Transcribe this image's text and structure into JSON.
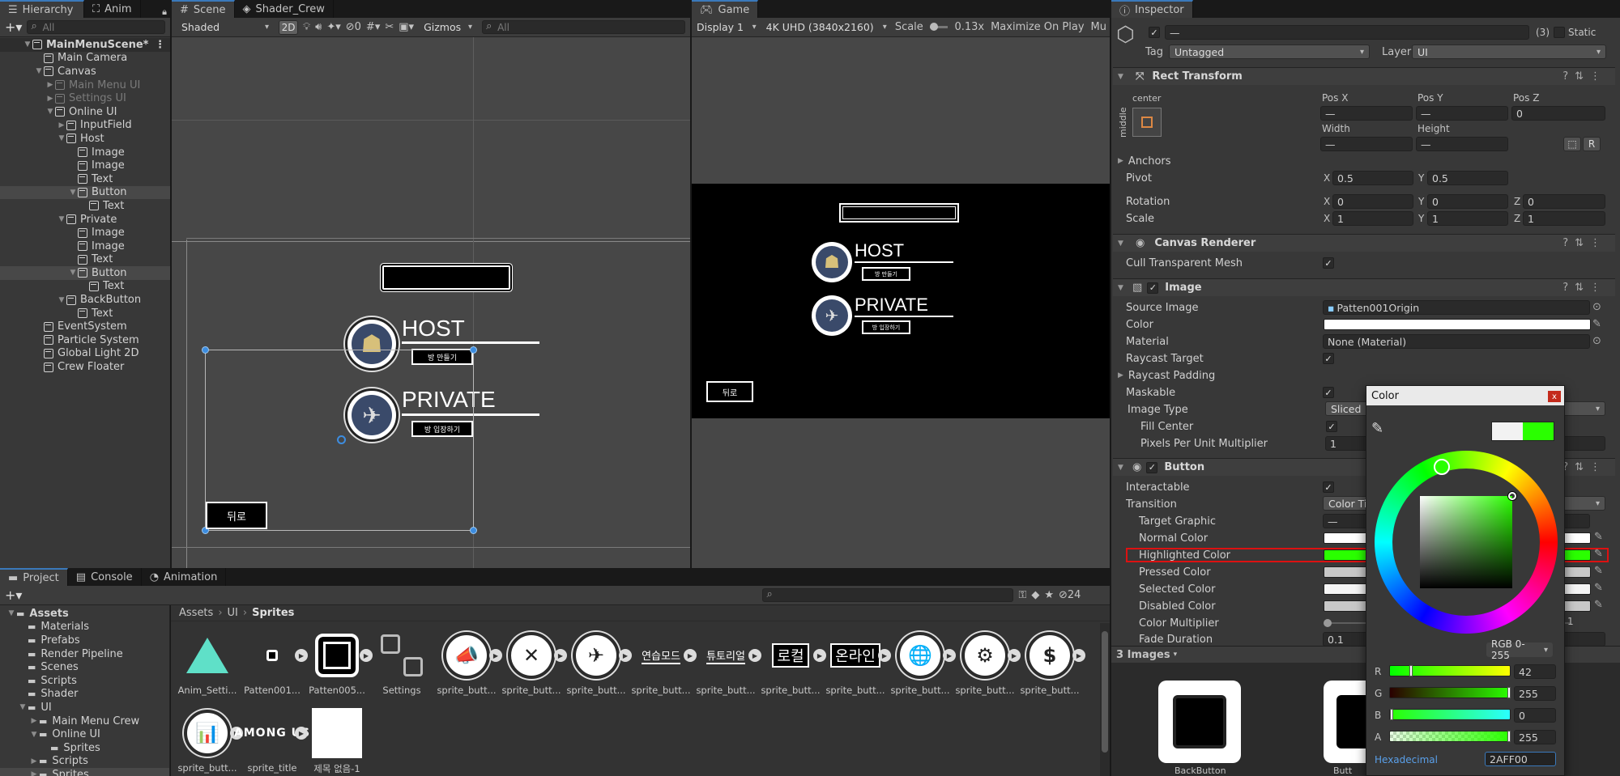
{
  "hierarchy": {
    "tabs": [
      "Hierarchy",
      "Anim"
    ],
    "search_placeholder": "All",
    "items": [
      {
        "label": "MainMenuScene*",
        "depth": 0,
        "kind": "scene",
        "expanded": true
      },
      {
        "label": "Main Camera",
        "depth": 1
      },
      {
        "label": "Canvas",
        "depth": 1,
        "expanded": true
      },
      {
        "label": "Main Menu UI",
        "depth": 2,
        "collapsed": true,
        "dim": true
      },
      {
        "label": "Settings UI",
        "depth": 2,
        "collapsed": true,
        "dim": true
      },
      {
        "label": "Online UI",
        "depth": 2,
        "expanded": true
      },
      {
        "label": "InputField",
        "depth": 3,
        "collapsed": true
      },
      {
        "label": "Host",
        "depth": 3,
        "expanded": true
      },
      {
        "label": "Image",
        "depth": 4
      },
      {
        "label": "Image",
        "depth": 4
      },
      {
        "label": "Text",
        "depth": 4
      },
      {
        "label": "Button",
        "depth": 4,
        "expanded": true,
        "selected": true
      },
      {
        "label": "Text",
        "depth": 5
      },
      {
        "label": "Private",
        "depth": 3,
        "expanded": true
      },
      {
        "label": "Image",
        "depth": 4
      },
      {
        "label": "Image",
        "depth": 4
      },
      {
        "label": "Text",
        "depth": 4
      },
      {
        "label": "Button",
        "depth": 4,
        "expanded": true,
        "selected": true
      },
      {
        "label": "Text",
        "depth": 5
      },
      {
        "label": "BackButton",
        "depth": 3,
        "expanded": true
      },
      {
        "label": "Text",
        "depth": 4
      },
      {
        "label": "EventSystem",
        "depth": 1
      },
      {
        "label": "Particle System",
        "depth": 1
      },
      {
        "label": "Global Light 2D",
        "depth": 1
      },
      {
        "label": "Crew Floater",
        "depth": 1
      }
    ]
  },
  "scene": {
    "tabs": [
      "Scene",
      "Shader_Crew"
    ],
    "shading": "Shaded",
    "mode2d": "2D",
    "gizmos": "Gizmos",
    "search_placeholder": "All",
    "hidden_count": "0",
    "host_label": "HOST",
    "host_button": "방 만들기",
    "private_label": "PRIVATE",
    "private_button": "방 입장하기",
    "back_button": "뒤로"
  },
  "game": {
    "tab": "Game",
    "display": "Display 1",
    "resolution": "4K UHD (3840x2160)",
    "scale_label": "Scale",
    "scale_value": "0.13x",
    "maximize": "Maximize On Play",
    "mute": "Mu",
    "host_label": "HOST",
    "host_button": "방 만들기",
    "private_label": "PRIVATE",
    "private_button": "방 입장하기",
    "back_button": "뒤로"
  },
  "project": {
    "tabs": [
      "Project",
      "Console",
      "Animation"
    ],
    "hidden_count": "24",
    "tree": [
      {
        "label": "Assets",
        "depth": 0,
        "bold": true
      },
      {
        "label": "Materials",
        "depth": 1
      },
      {
        "label": "Prefabs",
        "depth": 1
      },
      {
        "label": "Render Pipeline",
        "depth": 1
      },
      {
        "label": "Scenes",
        "depth": 1
      },
      {
        "label": "Scripts",
        "depth": 1
      },
      {
        "label": "Shader",
        "depth": 1
      },
      {
        "label": "UI",
        "depth": 1,
        "open": true
      },
      {
        "label": "Main Menu Crew",
        "depth": 2
      },
      {
        "label": "Online UI",
        "depth": 2,
        "open": true
      },
      {
        "label": "Sprites",
        "depth": 3
      },
      {
        "label": "Scripts",
        "depth": 2
      },
      {
        "label": "Sprites",
        "depth": 2,
        "selected": true
      }
    ],
    "breadcrumb": [
      "Assets",
      "UI",
      "Sprites"
    ],
    "assets": [
      {
        "label": "Anim_Setti...",
        "kind": "anim"
      },
      {
        "label": "Patten001...",
        "kind": "smallsq"
      },
      {
        "label": "Patten005...",
        "kind": "bigsq"
      },
      {
        "label": "Settings",
        "kind": "settings"
      },
      {
        "label": "sprite_butt...",
        "kind": "circle",
        "glyph": "📣"
      },
      {
        "label": "sprite_butt...",
        "kind": "circle",
        "glyph": "✕"
      },
      {
        "label": "sprite_butt...",
        "kind": "circle",
        "glyph": "✈"
      },
      {
        "label": "sprite_butt...",
        "kind": "text",
        "glyph": "연습모드"
      },
      {
        "label": "sprite_butt...",
        "kind": "text",
        "glyph": "튜토리얼"
      },
      {
        "label": "sprite_butt...",
        "kind": "boxtext",
        "glyph": "로컬"
      },
      {
        "label": "sprite_butt...",
        "kind": "boxtext",
        "glyph": "온라인"
      },
      {
        "label": "sprite_butt...",
        "kind": "circle",
        "glyph": "🌐"
      },
      {
        "label": "sprite_butt...",
        "kind": "circle",
        "glyph": "⚙"
      },
      {
        "label": "sprite_butt...",
        "kind": "circle",
        "glyph": "$"
      },
      {
        "label": "sprite_butt...",
        "kind": "circle",
        "glyph": "📊"
      },
      {
        "label": "sprite_title",
        "kind": "title",
        "glyph": "AMONG US"
      },
      {
        "label": "제목 없음-1",
        "kind": "white"
      }
    ]
  },
  "inspector": {
    "tab": "Inspector",
    "name": "—",
    "count": "(3)",
    "static": "Static",
    "tag_label": "Tag",
    "tag": "Untagged",
    "layer_label": "Layer",
    "layer": "UI",
    "rect": {
      "title": "Rect Transform",
      "anchor_h": "center",
      "anchor_v": "middle",
      "posx": "Pos X",
      "posy": "Pos Y",
      "posz": "Pos Z",
      "posx_v": "—",
      "posy_v": "—",
      "posz_v": "0",
      "width": "Width",
      "height": "Height",
      "width_v": "—",
      "height_v": "—",
      "anchors": "Anchors",
      "pivot": "Pivot",
      "pivot_x": "0.5",
      "pivot_y": "0.5",
      "rotation": "Rotation",
      "rot_x": "0",
      "rot_y": "0",
      "rot_z": "0",
      "scale": "Scale",
      "sc_x": "1",
      "sc_y": "1",
      "sc_z": "1",
      "r_btn": "R"
    },
    "canvas_renderer": {
      "title": "Canvas Renderer",
      "cull": "Cull Transparent Mesh"
    },
    "image": {
      "title": "Image",
      "source": "Source Image",
      "source_v": "Patten001Origin",
      "color": "Color",
      "material": "Material",
      "material_v": "None (Material)",
      "raycast": "Raycast Target",
      "raycast_padding": "Raycast Padding",
      "maskable": "Maskable",
      "image_type": "Image Type",
      "image_type_v": "Sliced",
      "fill_center": "Fill Center",
      "ppu": "Pixels Per Unit Multiplier",
      "ppu_v": "1"
    },
    "button": {
      "title": "Button",
      "interactable": "Interactable",
      "transition": "Transition",
      "transition_v": "Color Tint",
      "target": "Target Graphic",
      "target_v": "—",
      "normal": "Normal Color",
      "highlighted": "Highlighted Color",
      "pressed": "Pressed Color",
      "selected": "Selected Color",
      "disabled": "Disabled Color",
      "multiplier": "Color Multiplier",
      "multiplier_v": "1",
      "fade": "Fade Duration",
      "fade_v": "0.1"
    },
    "images_header": "3 Images",
    "preview_label1": "BackButton",
    "preview_label2": "Butt",
    "highlight_color": "#2AFF00"
  },
  "color_picker": {
    "title": "Color",
    "mode": "RGB 0-255",
    "r_label": "R",
    "g_label": "G",
    "b_label": "B",
    "a_label": "A",
    "r": "42",
    "g": "255",
    "b": "0",
    "a": "255",
    "hex_label": "Hexadecimal",
    "hex": "2AFF00",
    "close": "x"
  }
}
